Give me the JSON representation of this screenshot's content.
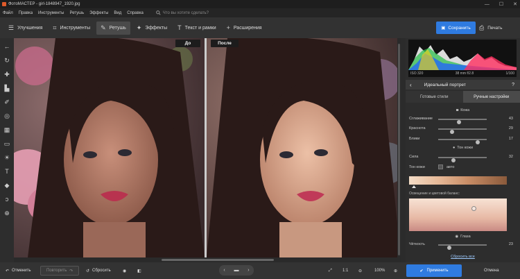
{
  "window": {
    "title": "ФотоМАСТЕР - girl-1848947_1920.jpg",
    "min": "—",
    "max": "☐",
    "close": "✕"
  },
  "menu": {
    "items": [
      "Файл",
      "Правка",
      "Инструменты",
      "Ретушь",
      "Эффекты",
      "Вид",
      "Справка"
    ],
    "search_placeholder": "Что вы хотите сделать?"
  },
  "toolbar": {
    "tabs": [
      {
        "label": "Улучшения",
        "icon": "sliders-icon"
      },
      {
        "label": "Инструменты",
        "icon": "crop-icon"
      },
      {
        "label": "Ретушь",
        "icon": "brush-icon",
        "active": true
      },
      {
        "label": "Эффекты",
        "icon": "sparkle-icon"
      },
      {
        "label": "Текст и рамки",
        "icon": "text-icon"
      },
      {
        "label": "Расширения",
        "icon": "plus-icon"
      }
    ],
    "save_label": "Сохранить",
    "print_label": "Печать"
  },
  "canvas": {
    "before_label": "До",
    "after_label": "После"
  },
  "histogram": {
    "iso": "ISO 320",
    "lens": "38 mm f/2.8",
    "shutter": "1/100"
  },
  "panel": {
    "title": "Идеальный портрет",
    "help": "?",
    "tabs": [
      "Готовые стили",
      "Ручные настройки"
    ],
    "skin_section": "Кожа",
    "sliders_skin": [
      {
        "label": "Сглаживание",
        "value": 43
      },
      {
        "label": "Краснота",
        "value": 29
      },
      {
        "label": "Блики",
        "value": 17
      }
    ],
    "tone_section": "Тон кожи",
    "sliders_tone": [
      {
        "label": "Сила",
        "value": 32
      }
    ],
    "tone_label": "Тон кожи",
    "auto_label": "авто",
    "lighting_label": "Освещение и цветовой баланс:",
    "eyes_section": "Глаза",
    "sliders_eyes": [
      {
        "label": "Чёткость",
        "value": 23
      }
    ],
    "reset_link": "Сбросить все"
  },
  "bottom": {
    "undo": "Отменить",
    "redo": "Повторить",
    "reset": "Сбросить",
    "ratio": "1:1",
    "zoom": "100%",
    "apply": "Применить",
    "cancel": "Отмена"
  },
  "colors": {
    "accent": "#2f7be0"
  }
}
